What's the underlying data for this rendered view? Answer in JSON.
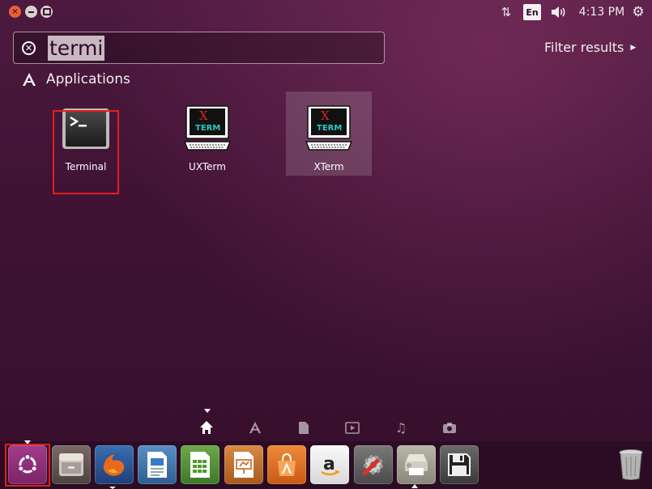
{
  "top_panel": {
    "clock": "4:13 PM",
    "keyboard_layout": "En",
    "icons": [
      "close-icon",
      "minimize-icon",
      "maximize-icon",
      "network-icon",
      "keyboard-layout-icon",
      "volume-icon",
      "system-gear-icon"
    ]
  },
  "search": {
    "query": "termi",
    "clear_icon": "close-circle-icon"
  },
  "filter": {
    "label": "Filter results",
    "arrow_icon": "triangle-right-icon"
  },
  "category": {
    "label": "Applications",
    "icon": "applications-icon"
  },
  "apps": [
    {
      "label": "Terminal",
      "icon": "terminal-icon"
    },
    {
      "label": "UXTerm",
      "icon": "xterm-icon"
    },
    {
      "label": "XTerm",
      "icon": "xterm-icon"
    }
  ],
  "xterm_icon_text": {
    "top": "X",
    "bottom": "TERM"
  },
  "lenses": [
    "home-lens-icon",
    "applications-lens-icon",
    "files-lens-icon",
    "video-lens-icon",
    "music-lens-icon",
    "photos-lens-icon"
  ],
  "launcher": [
    "ubuntu-dash-icon",
    "files-icon",
    "firefox-icon",
    "writer-icon",
    "calc-icon",
    "impress-icon",
    "software-center-icon",
    "amazon-icon",
    "system-settings-icon",
    "printer-icon",
    "save-icon",
    "trash-icon"
  ],
  "colors": {
    "background": "#3e1233",
    "highlight_border": "#e0201c",
    "accent_orange": "#e9603a"
  }
}
